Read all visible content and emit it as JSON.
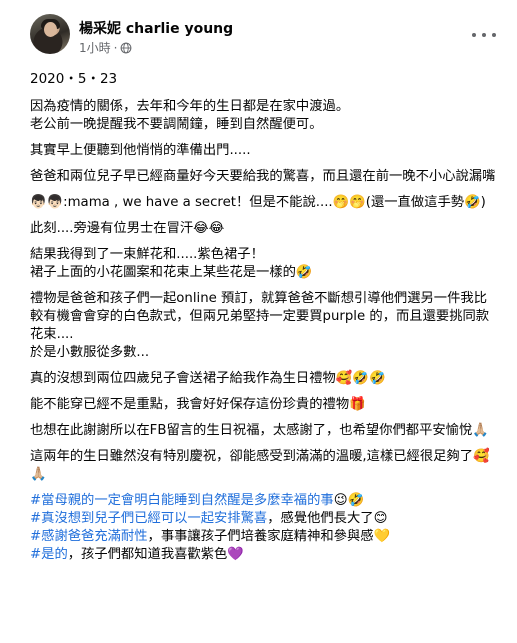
{
  "header": {
    "author_name": "楊采妮 charlie young",
    "timestamp": "1小時",
    "separator": "·",
    "privacy_icon": "globe-icon",
    "more_icon": "more-options-icon"
  },
  "post": {
    "date": "2020・5・23",
    "paragraphs": [
      "因為疫情的關係，去年和今年的生日都是在家中渡過。\n老公前一晚提醒我不要調鬧鐘，睡到自然醒便可。",
      "其實早上便聽到他悄悄的準備出門.....",
      "爸爸和兩位兒子早已經商量好今天要給我的驚喜，而且還在前一晚不小心說漏嘴",
      "👦🏻👦🏻:mama , we have a secret！但是不能說....🤭🤭(還一直做這手勢🤣)",
      "此刻....旁邊有位男士在冒汗😂😂",
      "結果我得到了一束鮮花和.....紫色裙子！\n裙子上面的小花圖案和花束上某些花是一樣的🤣",
      "禮物是爸爸和孩子們一起online 預訂，就算爸爸不斷想引導他們選另一件我比較有機會會穿的白色款式，但兩兄弟堅持一定要買purple 的，而且還要挑同款花束....\n於是小數服從多數...",
      "真的沒想到兩位四歲兒子會送裙子給我作為生日禮物🥰🤣🤣",
      "能不能穿已經不是重點，我會好好保存這份珍貴的禮物🎁",
      "也想在此謝謝所以在FB留言的生日祝福，太感謝了，也希望你們都平安愉悅🙏🏼",
      "這兩年的生日雖然沒有特別慶祝，卻能感受到滿滿的溫暖,這樣已經很足夠了🥰🙏🏼"
    ],
    "hashtag_lines": [
      {
        "tag": "#當母親的一定會明白能睡到自然醒是多麼幸福的事",
        "rest": "😉🤣"
      },
      {
        "tag": "#真沒想到兒子們已經可以一起安排驚喜",
        "rest": "，感覺他們長大了😊"
      },
      {
        "tag": "#感謝爸爸充滿耐性",
        "rest": "，事事讓孩子們培養家庭精神和參與感💛"
      },
      {
        "tag": "#是的",
        "rest": "，孩子們都知道我喜歡紫色💜"
      }
    ]
  },
  "colors": {
    "text": "#050505",
    "secondary": "#65676b",
    "hashtag": "#216fdb"
  }
}
